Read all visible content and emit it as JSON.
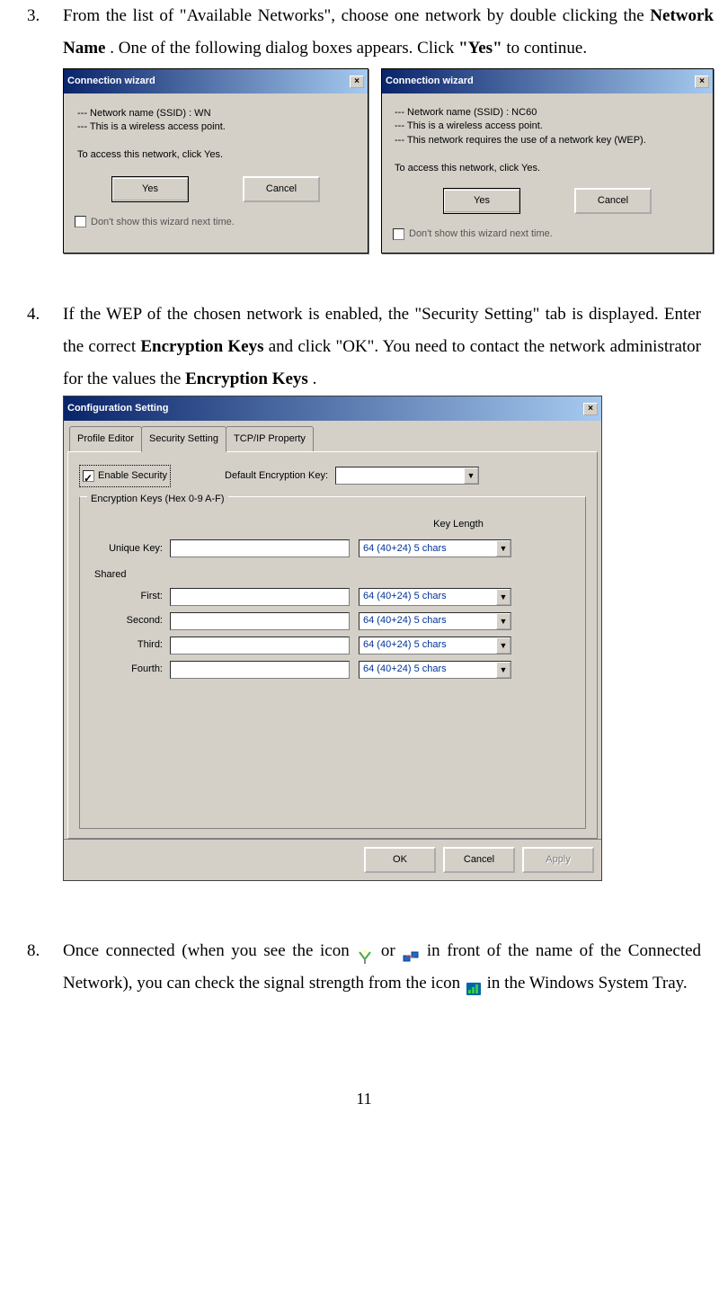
{
  "step3": {
    "num": "3.",
    "text_1": "From the list of \"Available Networks\", choose one network by double clicking the ",
    "bold_1": "Network Name",
    "text_2": ".  One of the following dialog boxes appears.  Click ",
    "bold_2": "\"Yes\"",
    "text_3": " to continue."
  },
  "dialog1": {
    "title": "Connection wizard",
    "line1": "--- Network name (SSID) : WN",
    "line2": "--- This is a wireless access point.",
    "prompt": "To access this network, click Yes.",
    "btn_yes": "Yes",
    "btn_cancel": "Cancel",
    "checkbox": "Don't show this wizard next time."
  },
  "dialog2": {
    "title": "Connection wizard",
    "line1": "--- Network name (SSID) : NC60",
    "line2": "--- This is a wireless access point.",
    "line3": "--- This network requires the use of a network key (WEP).",
    "prompt": "To access this network, click Yes.",
    "btn_yes": "Yes",
    "btn_cancel": "Cancel",
    "checkbox": "Don't show this wizard next time."
  },
  "step4": {
    "num": "4.",
    "text_1": "If the WEP of the chosen network is enabled, the \"Security Setting\" tab is displayed.  Enter the correct ",
    "bold_1": "Encryption Keys",
    "text_2": " and click \"OK\". You need to contact the network administrator for the values the ",
    "bold_2": "Encryption Keys",
    "text_3": "."
  },
  "config": {
    "title": "Configuration Setting",
    "tabs": {
      "tab1": "Profile Editor",
      "tab2": "Security Setting",
      "tab3": "TCP/IP Property"
    },
    "enable_security": "Enable Security",
    "default_key_label": "Default Encryption Key:",
    "fieldset_legend": "Encryption Keys (Hex 0-9 A-F)",
    "key_length_header": "Key Length",
    "labels": {
      "unique": "Unique Key:",
      "shared": "Shared",
      "first": "First:",
      "second": "Second:",
      "third": "Third:",
      "fourth": "Fourth:"
    },
    "dropdown_value": "64 (40+24) 5 chars",
    "buttons": {
      "ok": "OK",
      "cancel": "Cancel",
      "apply": "Apply"
    }
  },
  "step8": {
    "num": "8.",
    "text_1": "Once connected (when you see the icon ",
    "text_2": "or  ",
    "text_3": " in front of the name of the Connected Network), you can check the signal strength from the icon ",
    "text_4": " in the Windows System Tray."
  },
  "page_number": "11"
}
